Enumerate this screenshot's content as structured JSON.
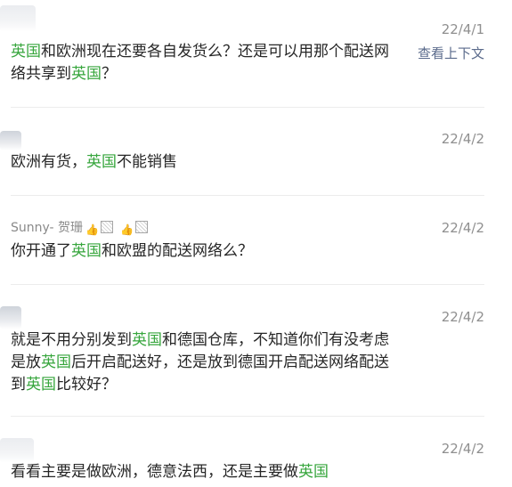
{
  "messages": [
    {
      "sender": "",
      "date": "22/4/1",
      "context_link": "查看上下文",
      "segments": [
        {
          "text": "英国",
          "hl": true
        },
        {
          "text": "和欧洲现在还要各自发货么？还是可以用那个配送网络共享到",
          "hl": false
        },
        {
          "text": "英国",
          "hl": true
        },
        {
          "text": "？",
          "hl": false
        }
      ]
    },
    {
      "sender": "",
      "date": "22/4/2",
      "segments": [
        {
          "text": "欧洲有货，",
          "hl": false
        },
        {
          "text": "英国",
          "hl": true
        },
        {
          "text": "不能销售",
          "hl": false
        }
      ]
    },
    {
      "sender": "Sunny- 贺珊",
      "emojis": [
        "thumbs-up",
        "boxed",
        "thumbs-up",
        "boxed"
      ],
      "date": "22/4/2",
      "segments": [
        {
          "text": "你开通了",
          "hl": false
        },
        {
          "text": "英国",
          "hl": true
        },
        {
          "text": "和欧盟的配送网络么？",
          "hl": false
        }
      ]
    },
    {
      "sender": "",
      "date": "22/4/2",
      "segments": [
        {
          "text": "就是不用分别发到",
          "hl": false
        },
        {
          "text": "英国",
          "hl": true
        },
        {
          "text": "和德国仓库，不知道你们有没考虑是放",
          "hl": false
        },
        {
          "text": "英国",
          "hl": true
        },
        {
          "text": "后开启配送好，还是放到德国开启配送网络配送到",
          "hl": false
        },
        {
          "text": "英国",
          "hl": true
        },
        {
          "text": "比较好？",
          "hl": false
        }
      ]
    },
    {
      "sender": "",
      "date": "22/4/2",
      "segments": [
        {
          "text": "看看主要是做欧洲，德意法西，还是主要做",
          "hl": false
        },
        {
          "text": "英国",
          "hl": true
        }
      ]
    }
  ],
  "colors": {
    "highlight": "#37a63d",
    "date": "#8f8f8f",
    "link": "#5b6b8c",
    "divider": "#ececec"
  }
}
